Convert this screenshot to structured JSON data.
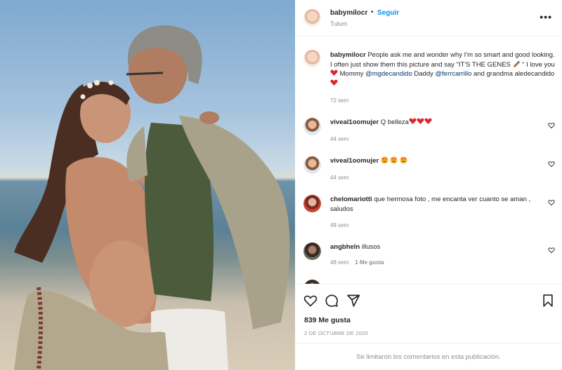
{
  "colors": {
    "link": "#0095f6",
    "mention": "#00376b",
    "heart": "#ed4956",
    "muted": "#8e8e8e"
  },
  "header": {
    "username": "babymilocr",
    "separator": "•",
    "follow_label": "Seguir",
    "location": "Tulum",
    "more_icon": "more-horizontal-icon"
  },
  "caption": {
    "username": "babymilocr",
    "text_1": " People ask me and wonder why I'm so smart and good looking. I often just show them this picture and say \"IT'S THE GENES ",
    "text_2": " \" I love you ",
    "text_3": " Mommy ",
    "mention_1": "@mgdecandido",
    "text_4": " Daddy ",
    "mention_2": "@ferrcarrillo",
    "text_5": " and grandma aledecandido ",
    "time": "72 sem"
  },
  "comments": [
    {
      "username": "viveal1oomujer",
      "text": " Q belleza",
      "time": "44 sem",
      "likes": ""
    },
    {
      "username": "viveal1oomujer",
      "text": " ",
      "time": "44 sem",
      "likes": ""
    },
    {
      "username": "chelomariotti",
      "text": " que hermosa foto , me encanta ver cuanto se aman , saludos",
      "time": "48 sem",
      "likes": ""
    },
    {
      "username": "angbheln",
      "text": " illusos",
      "time": "48 sem",
      "likes": "1 Me gusta"
    }
  ],
  "actions": {
    "like_icon": "heart-icon",
    "comment_icon": "comment-icon",
    "share_icon": "send-icon",
    "save_icon": "bookmark-icon",
    "like_count": "839 Me gusta",
    "date": "2 DE OCTUBRE DE 2020",
    "comments_limited": "Se limitaron los comentarios en esta publicación."
  }
}
